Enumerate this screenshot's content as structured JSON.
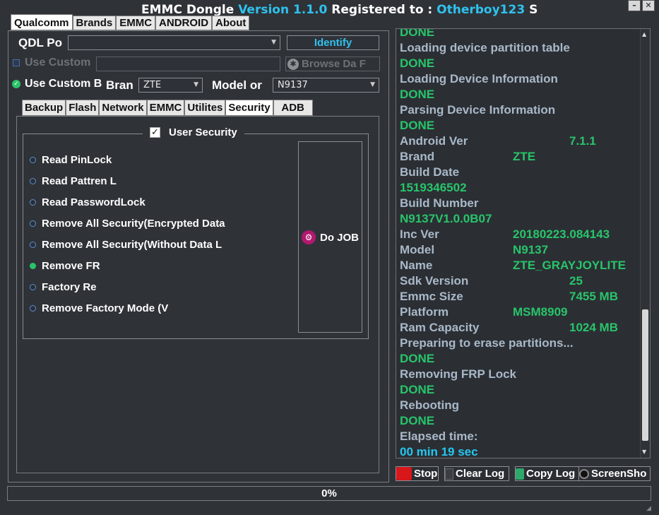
{
  "window": {
    "title_prefix": "EMMC Dongle ",
    "version": "Version 1.1.0",
    "registered_label": " Registered to : ",
    "user": "Otherboy123",
    "user_suffix": " S",
    "minimize": "–",
    "close": "✕"
  },
  "main_tabs": [
    "Qualcomm",
    "Brands",
    "EMMC",
    "ANDROID",
    "About"
  ],
  "qdl": {
    "label": "QDL Po",
    "port_value": "",
    "identify": "Identify"
  },
  "custom_loader": {
    "label": "Use Custom",
    "path": "",
    "browse": "Browse Da F"
  },
  "custom_brand": {
    "label": "Use Custom B",
    "brand_label": "Bran",
    "brand_value": "ZTE",
    "model_label": "Model or",
    "model_value": "N9137"
  },
  "sub_tabs": [
    "Backup",
    "Flash",
    "Network",
    "EMMC",
    "Utilites",
    "Security",
    "ADB"
  ],
  "security": {
    "group_title": "User Security",
    "options": [
      {
        "label": "Read PinLock",
        "selected": false
      },
      {
        "label": "Read Pattren L",
        "selected": false
      },
      {
        "label": "Read PasswordLock",
        "selected": false
      },
      {
        "label": "Remove All Security(Encrypted Data",
        "selected": false
      },
      {
        "label": "Remove All Security(Without Data L",
        "selected": false
      },
      {
        "label": "Remove FR",
        "selected": true
      },
      {
        "label": "Factory Re",
        "selected": false
      },
      {
        "label": "Remove Factory Mode (V",
        "selected": false
      }
    ],
    "do_job": "Do JOB"
  },
  "log": {
    "lines": [
      {
        "text": "DONE",
        "kind": "done"
      },
      {
        "text": "Loading device partition table",
        "kind": "info"
      },
      {
        "text": "DONE",
        "kind": "done"
      },
      {
        "text": "Loading Device Information",
        "kind": "info"
      },
      {
        "text": "DONE",
        "kind": "done"
      },
      {
        "text": "Parsing Device Information",
        "kind": "info"
      },
      {
        "text": "DONE",
        "kind": "done"
      },
      {
        "text": "Android Ver",
        "kind": "info",
        "value": "7.1.1",
        "col": 2
      },
      {
        "text": "Brand",
        "kind": "info",
        "value": "ZTE",
        "col": 1
      },
      {
        "text": "Build Date",
        "kind": "info"
      },
      {
        "text": "1519346502",
        "kind": "done"
      },
      {
        "text": "Build Number",
        "kind": "info"
      },
      {
        "text": "N9137V1.0.0B07",
        "kind": "done"
      },
      {
        "text": "Inc Ver",
        "kind": "info",
        "value": "20180223.084143",
        "col": 1
      },
      {
        "text": "Model",
        "kind": "info",
        "value": "N9137",
        "col": 1
      },
      {
        "text": "Name",
        "kind": "info",
        "value": "ZTE_GRAYJOYLITE",
        "col": 1
      },
      {
        "text": "Sdk Version",
        "kind": "info",
        "value": "25",
        "col": 2
      },
      {
        "text": "Emmc Size",
        "kind": "info",
        "value": "7455 MB",
        "col": 2
      },
      {
        "text": "Platform",
        "kind": "info",
        "value": "MSM8909",
        "col": 1
      },
      {
        "text": "Ram Capacity",
        "kind": "info",
        "value": "1024 MB",
        "col": 2
      },
      {
        "text": "Preparing to erase partitions...",
        "kind": "info"
      },
      {
        "text": "DONE",
        "kind": "done"
      },
      {
        "text": "Removing FRP Lock",
        "kind": "info"
      },
      {
        "text": "DONE",
        "kind": "done"
      },
      {
        "text": "Rebooting",
        "kind": "info"
      },
      {
        "text": "DONE",
        "kind": "done"
      },
      {
        "text": "Elapsed time:",
        "kind": "info"
      },
      {
        "text": "00 min  19 sec",
        "kind": "cyan"
      }
    ]
  },
  "bottom_buttons": {
    "stop": "Stop",
    "clear_log": "Clear Log",
    "copy_log": "Copy Log",
    "screenshot": "ScreenSho"
  },
  "progress": {
    "value": 0,
    "text": "0%"
  },
  "colors": {
    "done": "#28c46b",
    "info": "#a9b8c8",
    "cyan": "#26c7f0",
    "accent": "#2fc2ee"
  }
}
